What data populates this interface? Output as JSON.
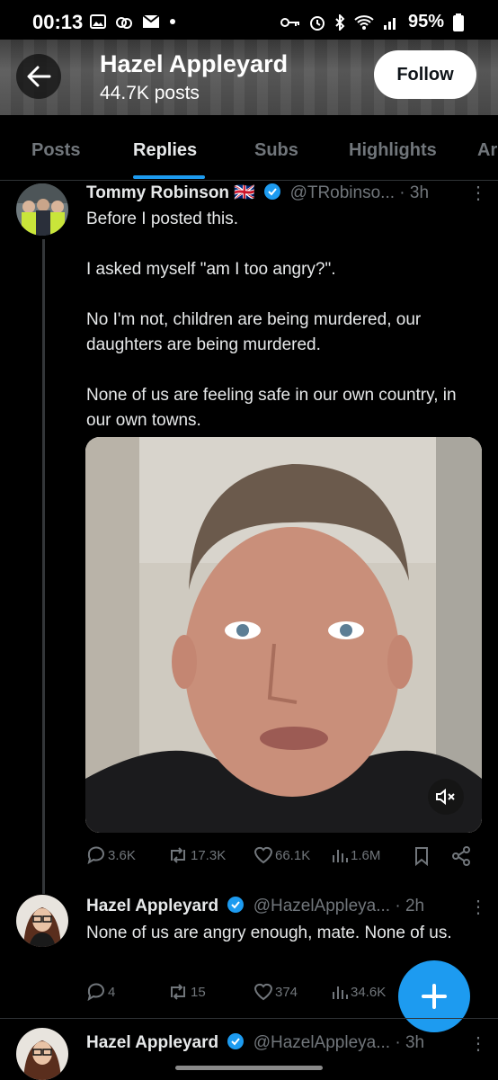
{
  "status_bar": {
    "time": "00:13",
    "battery": "95%"
  },
  "header": {
    "name": "Hazel Appleyard",
    "posts": "44.7K posts",
    "follow_label": "Follow"
  },
  "tabs": [
    "Posts",
    "Replies",
    "Subs",
    "Highlights",
    "Ar"
  ],
  "active_tab": "Replies",
  "posts": [
    {
      "name": "Tommy Robinson",
      "flag": "🇬🇧",
      "handle": "@TRobinso...",
      "time": "· 3h",
      "paragraphs": [
        "Before I posted this.",
        "I asked myself \"am I too angry?\".",
        "No I'm not, children are being murdered, our daughters are being murdered.",
        "None of us are feeling safe in our own country, in our own towns."
      ],
      "replies": "3.6K",
      "reposts": "17.3K",
      "likes": "66.1K",
      "views": "1.6M"
    },
    {
      "name": "Hazel Appleyard",
      "handle": "@HazelApplеya...",
      "time": "· 2h",
      "text": "None of us are angry enough, mate. None of us.",
      "replies": "4",
      "reposts": "15",
      "likes": "374",
      "views": "34.6K"
    },
    {
      "name": "Hazel Appleyard",
      "handle": "@HazelApplеya...",
      "time": "· 3h"
    }
  ],
  "colors": {
    "accent": "#1d9bf0",
    "muted": "#71767b",
    "text": "#e7e9ea"
  }
}
